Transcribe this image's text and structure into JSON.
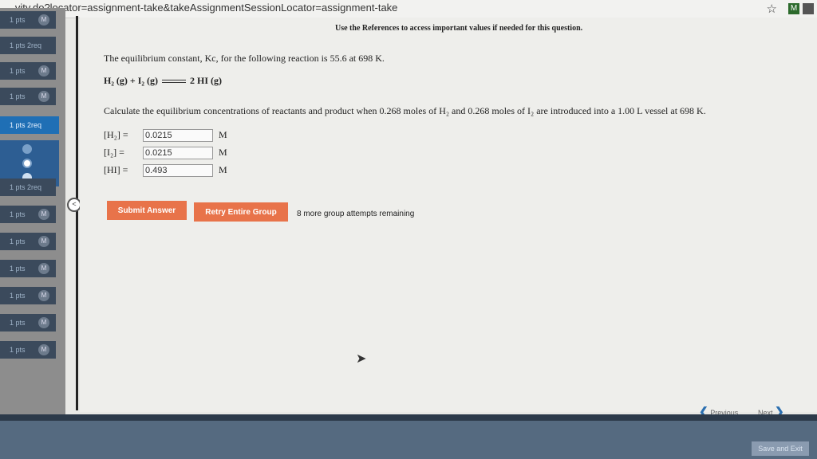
{
  "browser": {
    "url": "...vity.do?locator=assignment-take&takeAssignmentSessionLocator=assignment-take",
    "ext_label": "M"
  },
  "sidebar": {
    "items": [
      {
        "label": "1 pts",
        "badge": "M"
      },
      {
        "label": "1 pts  2req",
        "badge": ""
      },
      {
        "label": "1 pts",
        "badge": "M"
      },
      {
        "label": "1 pts",
        "badge": "M"
      },
      {
        "label": "1 pts  2req",
        "badge": "",
        "active": true
      },
      {
        "label": "1 pts  2req",
        "badge": ""
      },
      {
        "label": "1 pts",
        "badge": "M"
      },
      {
        "label": "1 pts",
        "badge": "M"
      },
      {
        "label": "1 pts",
        "badge": "M"
      },
      {
        "label": "1 pts",
        "badge": "M"
      },
      {
        "label": "1 pts",
        "badge": "M"
      },
      {
        "label": "1 pts",
        "badge": "M"
      }
    ],
    "collapse_label": "<"
  },
  "content": {
    "references": "Use the References to access important values if needed for this question.",
    "intro": "The equilibrium constant, Kc, for the following reaction is 55.6 at 698 K.",
    "reaction_left": "H₂ (g) + I₂ (g)",
    "reaction_right": "2 HI (g)",
    "question": "Calculate the equilibrium concentrations of reactants and product when 0.268 moles of H₂ and 0.268 moles of I₂ are introduced into a 1.00 L vessel at 698 K.",
    "answers": [
      {
        "label": "[H₂] =",
        "value": "0.0215",
        "unit": "M"
      },
      {
        "label": "[I₂] =",
        "value": "0.0215",
        "unit": "M"
      },
      {
        "label": "[HI] =",
        "value": "0.493",
        "unit": "M"
      }
    ],
    "submit_label": "Submit Answer",
    "retry_label": "Retry Entire Group",
    "attempts_text": "8 more group attempts remaining",
    "prev_label": "Previous",
    "next_label": "Next"
  },
  "footer": {
    "save_exit_label": "Save and Exit"
  }
}
